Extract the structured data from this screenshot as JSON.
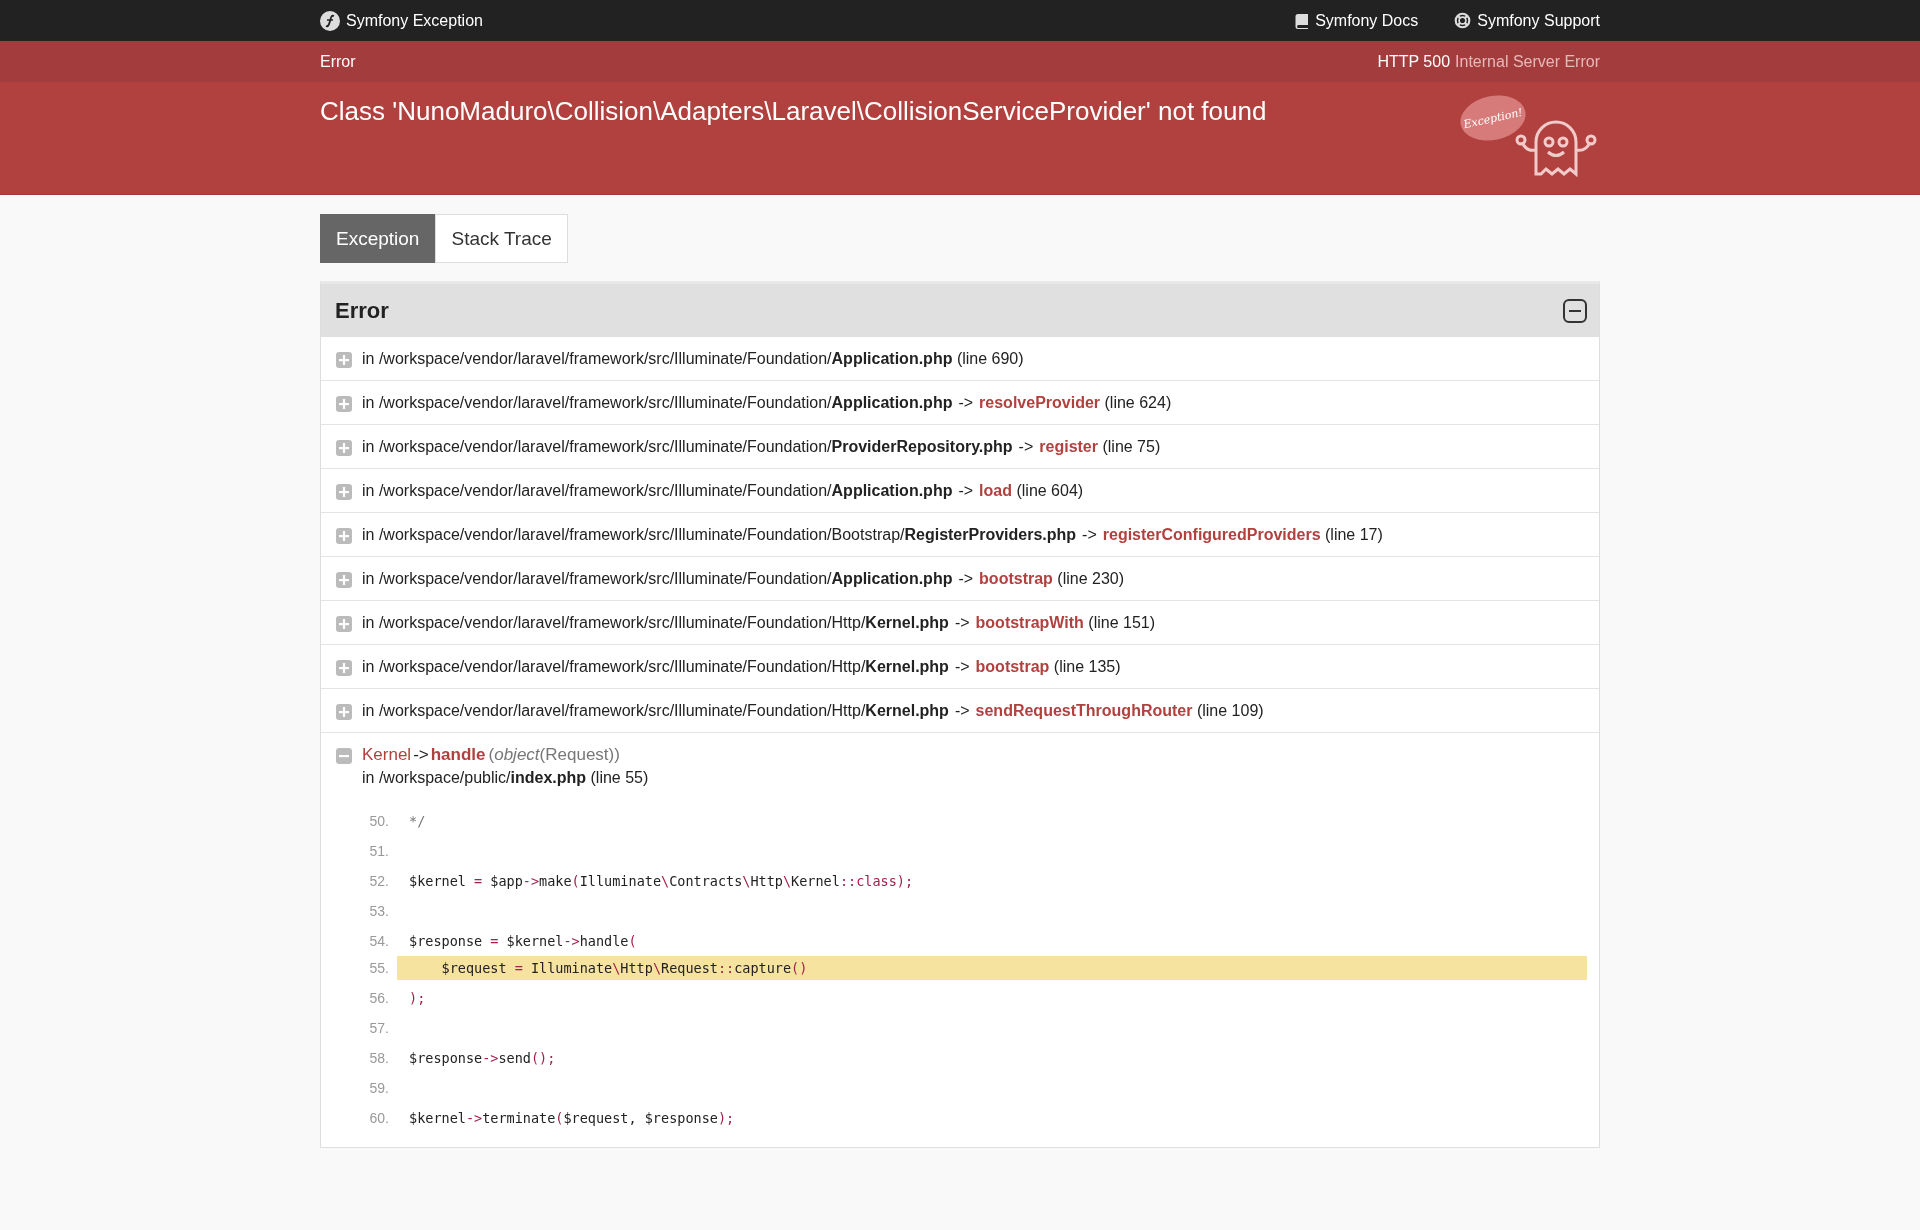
{
  "topbar": {
    "brand": "Symfony Exception",
    "links": [
      {
        "kind": "docs",
        "label": "Symfony Docs"
      },
      {
        "kind": "support",
        "label": "Symfony Support"
      }
    ]
  },
  "status": {
    "label": "Error",
    "code": "HTTP 500",
    "text": "Internal Server Error"
  },
  "header": {
    "message": "Class 'NunoMaduro\\Collision\\Adapters\\Laravel\\CollisionServiceProvider' not found",
    "mascot_bubble": "Exception!"
  },
  "tabs": [
    {
      "label": "Exception",
      "selected": true
    },
    {
      "label": "Stack Trace",
      "selected": false
    }
  ],
  "panel": {
    "title": "Error",
    "expanded": true
  },
  "traces": [
    {
      "expanded": false,
      "path": "in /workspace/vendor/laravel/framework/src/Illuminate/Foundation/",
      "file": "Application.php",
      "line": "(line 690)"
    },
    {
      "expanded": false,
      "path": "in /workspace/vendor/laravel/framework/src/Illuminate/Foundation/",
      "file": "Application.php",
      "arrow": "->",
      "function": "resolveProvider",
      "line": "(line 624)"
    },
    {
      "expanded": false,
      "path": "in /workspace/vendor/laravel/framework/src/Illuminate/Foundation/",
      "file": "ProviderRepository.php",
      "arrow": "->",
      "function": "register",
      "line": "(line 75)"
    },
    {
      "expanded": false,
      "path": "in /workspace/vendor/laravel/framework/src/Illuminate/Foundation/",
      "file": "Application.php",
      "arrow": "->",
      "function": "load",
      "line": "(line 604)"
    },
    {
      "expanded": false,
      "path": "in /workspace/vendor/laravel/framework/src/Illuminate/Foundation/Bootstrap/",
      "file": "RegisterProviders.php",
      "arrow": "->",
      "function": "registerConfiguredProviders",
      "line": "(line 17)"
    },
    {
      "expanded": false,
      "path": "in /workspace/vendor/laravel/framework/src/Illuminate/Foundation/",
      "file": "Application.php",
      "arrow": "->",
      "function": "bootstrap",
      "line": "(line 230)"
    },
    {
      "expanded": false,
      "path": "in /workspace/vendor/laravel/framework/src/Illuminate/Foundation/Http/",
      "file": "Kernel.php",
      "arrow": "->",
      "function": "bootstrapWith",
      "line": "(line 151)"
    },
    {
      "expanded": false,
      "path": "in /workspace/vendor/laravel/framework/src/Illuminate/Foundation/Http/",
      "file": "Kernel.php",
      "arrow": "->",
      "function": "bootstrap",
      "line": "(line 135)"
    },
    {
      "expanded": false,
      "path": "in /workspace/vendor/laravel/framework/src/Illuminate/Foundation/Http/",
      "file": "Kernel.php",
      "arrow": "->",
      "function": "sendRequestThroughRouter",
      "line": "(line 109)"
    },
    {
      "expanded": true,
      "class": "Kernel",
      "arrow": "->",
      "function": "handle",
      "args": "(*object*(Request))",
      "path": "in /workspace/public/",
      "file": "index.php",
      "line": "(line 55)",
      "code": [
        {
          "number": "50.",
          "highlighted": false,
          "tokens": [
            {
              "kind": "comment",
              "text": "*/"
            }
          ]
        },
        {
          "number": "51.",
          "highlighted": false
        },
        {
          "number": "52.",
          "highlighted": false,
          "tokens": [
            {
              "kind": "plain",
              "text": "$kernel "
            },
            {
              "kind": "op",
              "text": "="
            },
            {
              "kind": "plain",
              "text": " $app"
            },
            {
              "kind": "op",
              "text": "->"
            },
            {
              "kind": "plain",
              "text": "make"
            },
            {
              "kind": "op",
              "text": "("
            },
            {
              "kind": "plain",
              "text": "Illuminate"
            },
            {
              "kind": "op",
              "text": "\\"
            },
            {
              "kind": "plain",
              "text": "Contracts"
            },
            {
              "kind": "op",
              "text": "\\"
            },
            {
              "kind": "plain",
              "text": "Http"
            },
            {
              "kind": "op",
              "text": "\\"
            },
            {
              "kind": "plain",
              "text": "Kernel"
            },
            {
              "kind": "op",
              "text": "::class);"
            }
          ]
        },
        {
          "number": "53.",
          "highlighted": false
        },
        {
          "number": "54.",
          "highlighted": false,
          "tokens": [
            {
              "kind": "plain",
              "text": "$response "
            },
            {
              "kind": "op",
              "text": "="
            },
            {
              "kind": "plain",
              "text": " $kernel"
            },
            {
              "kind": "op",
              "text": "->"
            },
            {
              "kind": "plain",
              "text": "handle"
            },
            {
              "kind": "op",
              "text": "("
            }
          ]
        },
        {
          "number": "55.",
          "highlighted": true,
          "tokens": [
            {
              "kind": "plain",
              "text": "    $request "
            },
            {
              "kind": "op",
              "text": "="
            },
            {
              "kind": "plain",
              "text": " Illuminate"
            },
            {
              "kind": "op",
              "text": "\\"
            },
            {
              "kind": "plain",
              "text": "Http"
            },
            {
              "kind": "op",
              "text": "\\"
            },
            {
              "kind": "plain",
              "text": "Request"
            },
            {
              "kind": "op",
              "text": "::"
            },
            {
              "kind": "plain",
              "text": "capture"
            },
            {
              "kind": "op",
              "text": "()"
            }
          ]
        },
        {
          "number": "56.",
          "highlighted": false,
          "tokens": [
            {
              "kind": "op",
              "text": ");"
            }
          ]
        },
        {
          "number": "57.",
          "highlighted": false
        },
        {
          "number": "58.",
          "highlighted": false,
          "tokens": [
            {
              "kind": "plain",
              "text": "$response"
            },
            {
              "kind": "op",
              "text": "->"
            },
            {
              "kind": "plain",
              "text": "send"
            },
            {
              "kind": "op",
              "text": "();"
            }
          ]
        },
        {
          "number": "59.",
          "highlighted": false
        },
        {
          "number": "60.",
          "highlighted": false,
          "tokens": [
            {
              "kind": "plain",
              "text": "$kernel"
            },
            {
              "kind": "op",
              "text": "->"
            },
            {
              "kind": "plain",
              "text": "terminate"
            },
            {
              "kind": "op",
              "text": "("
            },
            {
              "kind": "plain",
              "text": "$request, $response"
            },
            {
              "kind": "op",
              "text": ");"
            }
          ]
        }
      ]
    }
  ]
}
